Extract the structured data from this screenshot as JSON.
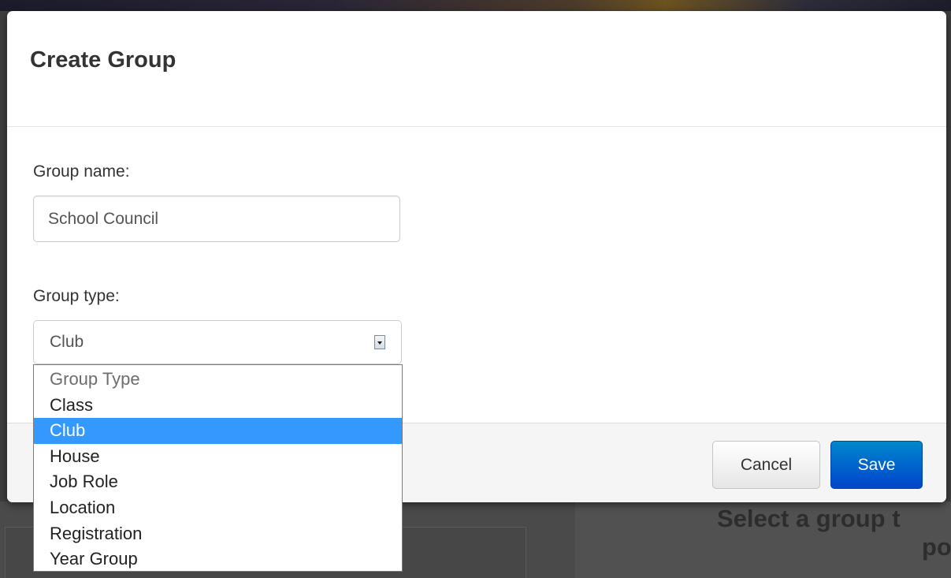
{
  "modal": {
    "title": "Create Group"
  },
  "form": {
    "group_name_label": "Group name:",
    "group_name_value": "School Council",
    "group_type_label": "Group type:",
    "group_type_value": "Club"
  },
  "dropdown": {
    "options": [
      "Group Type",
      "Class",
      "Club",
      "House",
      "Job Role",
      "Location",
      "Registration",
      "Year Group"
    ],
    "selected": "Club"
  },
  "footer": {
    "cancel_label": "Cancel",
    "save_label": "Save"
  },
  "background": {
    "line1": "Select a group t",
    "line2": "po"
  },
  "colors": {
    "save_button": "#0055cc",
    "selected_option": "#3399ff"
  }
}
